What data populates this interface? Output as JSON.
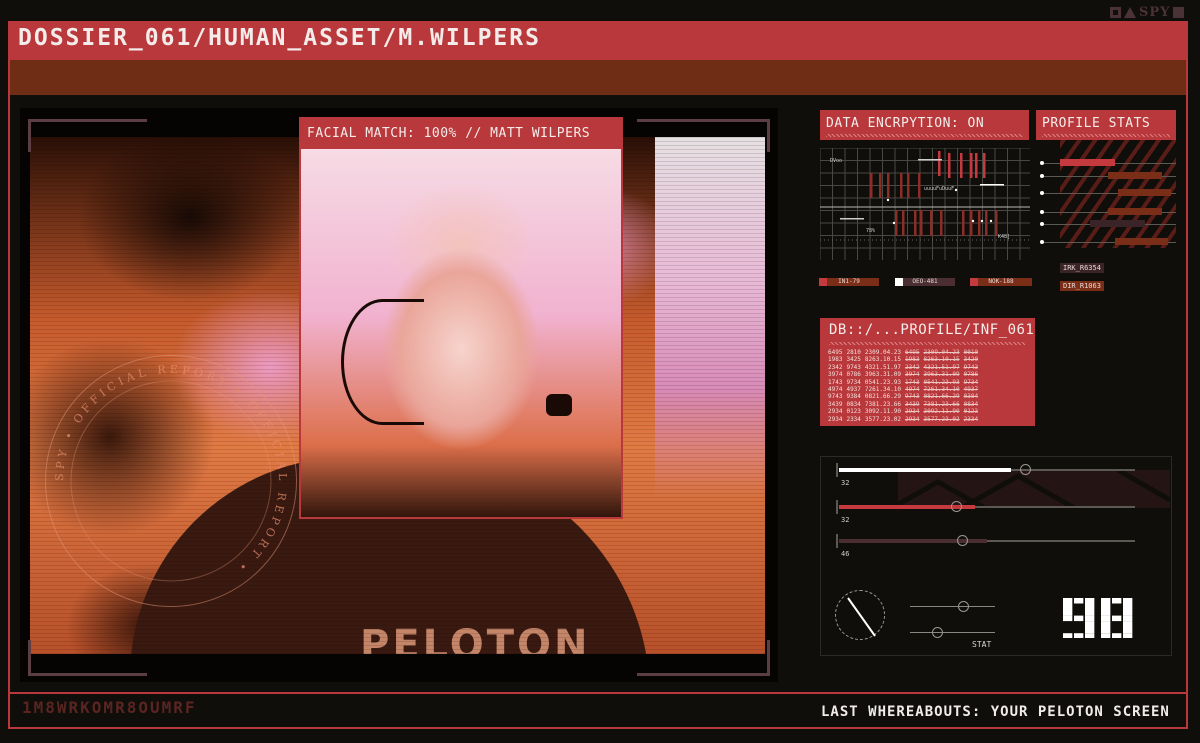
{
  "logo": {
    "text": "SPY"
  },
  "header": {
    "title": "DOSSIER_061/HUMAN_ASSET/M.WILPERS"
  },
  "photo": {
    "facial_match_label": "FACIAL MATCH: 100% // MATT WILPERS",
    "stamp_text": "SPY • OFFICIAL REPORT • OFFICIAL REPORT •",
    "shirt_text": "PELOTON"
  },
  "encryption": {
    "title": "DATA ENCRPYTION: ON",
    "chart_labels": [
      "DVoo",
      "uuuuFuDuuF",
      "78%",
      "K48]"
    ],
    "legend": [
      "IN1-79",
      "OEO-481",
      "NOK-188"
    ]
  },
  "profile_stats": {
    "title": "PROFILE STATS",
    "bars": [
      {
        "start": 0.15,
        "end": 0.55,
        "color": "#c43a3f"
      },
      {
        "start": 0.5,
        "end": 0.9,
        "color": "#7a2e18"
      },
      {
        "start": 0.57,
        "end": 0.96,
        "color": "#7a2e18"
      },
      {
        "start": 0.5,
        "end": 0.9,
        "color": "#7a2e18"
      },
      {
        "start": 0.37,
        "end": 0.77,
        "color": "#3a2428"
      },
      {
        "start": 0.55,
        "end": 0.94,
        "color": "#7a2e18"
      }
    ],
    "tags": [
      "IRK_R6354",
      "DIR_R1063"
    ]
  },
  "database": {
    "title": "DB::/...PROFILE/INF_061",
    "rows": [
      [
        "6495",
        "2810",
        "2309.04.23",
        "6495",
        "2309.04.23",
        "0010"
      ],
      [
        "1983",
        "3425",
        "8263.10.15",
        "1983",
        "8263.10.15",
        "3420"
      ],
      [
        "2342",
        "9743",
        "4321.51.97",
        "2342",
        "4321.51.97",
        "9743"
      ],
      [
        "3974",
        "0786",
        "3963.31.09",
        "3974",
        "3963.31.09",
        "0786"
      ],
      [
        "1743",
        "9734",
        "0541.23.93",
        "1743",
        "0541.23.93",
        "9734"
      ],
      [
        "4974",
        "4937",
        "7261.34.10",
        "4974",
        "7261.34.10",
        "4937"
      ],
      [
        "9743",
        "9384",
        "0821.66.29",
        "9743",
        "0821.66.29",
        "0384"
      ],
      [
        "3439",
        "0834",
        "7381.23.66",
        "3439",
        "7381.23.66",
        "0834"
      ],
      [
        "2934",
        "0123",
        "3092.11.90",
        "2934",
        "3092.11.90",
        "0123"
      ],
      [
        "2934",
        "2334",
        "3577.23.02",
        "2934",
        "3577.23.02",
        "2334"
      ]
    ]
  },
  "controls": {
    "sliders": [
      {
        "label": "32",
        "fill": 0.58,
        "knob": 0.61,
        "color": "#ffffff"
      },
      {
        "label": "32",
        "fill": 0.46,
        "knob": 0.38,
        "color": "#c43a3f"
      },
      {
        "label": "46",
        "fill": 0.5,
        "knob": 0.4,
        "color": "#4a2e32"
      }
    ],
    "mini_sliders": [
      0.62,
      0.32
    ],
    "stat_label": "STAT",
    "stat_value": "98"
  },
  "footer": {
    "left_text": "1M8WRKOMR8OUMRF",
    "right_text": "LAST WHEREABOUTS: YOUR PELOTON SCREEN"
  }
}
